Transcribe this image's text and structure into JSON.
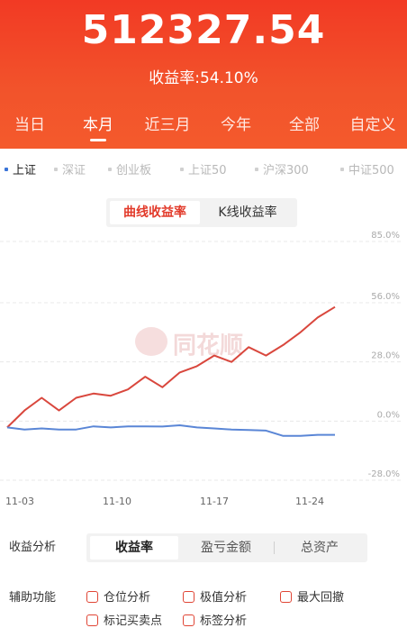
{
  "header": {
    "total_amount": "512327.54",
    "rate_label": "收益率:",
    "rate_value": "54.10%",
    "tabs": [
      {
        "label": "当日"
      },
      {
        "label": "本月"
      },
      {
        "label": "近三月"
      },
      {
        "label": "今年"
      },
      {
        "label": "全部"
      },
      {
        "label": "自定义"
      }
    ],
    "active_tab": "本月"
  },
  "indices": [
    {
      "label": "上证"
    },
    {
      "label": "深证"
    },
    {
      "label": "创业板"
    },
    {
      "label": "上证50"
    },
    {
      "label": "沪深300"
    },
    {
      "label": "中证500"
    }
  ],
  "active_index": "上证",
  "chart_switch": {
    "options": [
      "曲线收益率",
      "K线收益率"
    ],
    "active": "曲线收益率"
  },
  "watermark": {
    "text": "同花顺"
  },
  "chart_data": {
    "type": "line",
    "x_tick_labels": [
      "11-03",
      "11-10",
      "11-17",
      "11-24"
    ],
    "y_tick_labels": [
      "85.0%",
      "56.0%",
      "28.0%",
      "0.0%",
      "-28.0%"
    ],
    "ylim": [
      -28,
      85
    ],
    "grid": true,
    "series": [
      {
        "color": "#d9473d",
        "values": [
          -3,
          5,
          11,
          5,
          11,
          13,
          12,
          15,
          21,
          16,
          23,
          26,
          31,
          28,
          35,
          31,
          36,
          42,
          49,
          54
        ]
      },
      {
        "color": "#5a86d6",
        "values": [
          -3,
          -4,
          -3.5,
          -4,
          -4,
          -2.5,
          -3,
          -2.5,
          -2.5,
          -2.6,
          -2,
          -3,
          -3.5,
          -4,
          -4.2,
          -4.5,
          -7,
          -7,
          -6.5,
          -6.5
        ]
      }
    ]
  },
  "analysis": {
    "label": "收益分析",
    "tabs": [
      "收益率",
      "盈亏金额",
      "总资产"
    ],
    "active": "收益率"
  },
  "aux": {
    "label": "辅助功能",
    "options": [
      "仓位分析",
      "极值分析",
      "最大回撤",
      "标记买卖点",
      "标签分析"
    ]
  }
}
